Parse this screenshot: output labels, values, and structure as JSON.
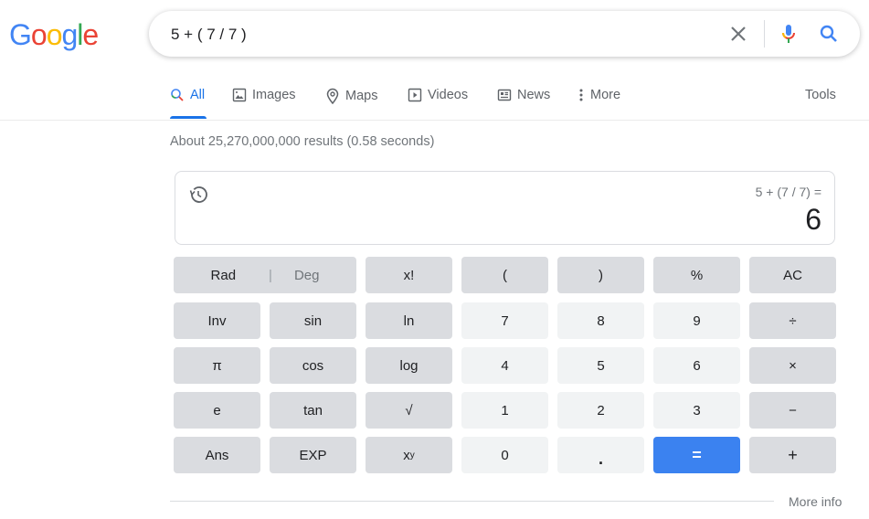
{
  "logo": {
    "letters": [
      {
        "char": "G",
        "color": "#4285f4"
      },
      {
        "char": "o",
        "color": "#ea4335"
      },
      {
        "char": "o",
        "color": "#fbbc05"
      },
      {
        "char": "g",
        "color": "#4285f4"
      },
      {
        "char": "l",
        "color": "#34a853"
      },
      {
        "char": "e",
        "color": "#ea4335"
      }
    ]
  },
  "search": {
    "query": "5 + ( 7 / 7 )",
    "clear_icon": "close-icon",
    "voice_icon": "microphone-icon",
    "search_icon": "search-icon"
  },
  "tabs": [
    {
      "label": "All",
      "icon": "search-icon",
      "active": true
    },
    {
      "label": "Images",
      "icon": "image-icon"
    },
    {
      "label": "Maps",
      "icon": "map-pin-icon"
    },
    {
      "label": "Videos",
      "icon": "video-icon"
    },
    {
      "label": "News",
      "icon": "newspaper-icon"
    },
    {
      "label": "More",
      "icon": "more-vert-icon"
    }
  ],
  "tools_label": "Tools",
  "result_stats": "About 25,270,000,000 results (0.58 seconds)",
  "calculator": {
    "expression": "5 + (7 / 7) =",
    "result": "6",
    "mode": {
      "rad": "Rad",
      "separator": "|",
      "deg": "Deg"
    },
    "keys": {
      "fact": "x!",
      "lparen": "(",
      "rparen": ")",
      "percent": "%",
      "ac": "AC",
      "inv": "Inv",
      "sin": "sin",
      "ln": "ln",
      "seven": "7",
      "eight": "8",
      "nine": "9",
      "divide": "÷",
      "pi": "π",
      "cos": "cos",
      "log": "log",
      "four": "4",
      "five": "5",
      "six": "6",
      "multiply": "×",
      "e": "e",
      "tan": "tan",
      "sqrt": "√",
      "one": "1",
      "two": "2",
      "three": "3",
      "minus": "−",
      "ans": "Ans",
      "exp": "EXP",
      "pow_base": "x",
      "pow_exp": "y",
      "zero": "0",
      "dot": ".",
      "equals": "=",
      "plus": "+"
    }
  },
  "more_info": "More info",
  "colors": {
    "accent": "#1a73e8",
    "equals_key": "#3b82f0",
    "op_key": "#dadce0",
    "num_key": "#f1f3f4"
  }
}
